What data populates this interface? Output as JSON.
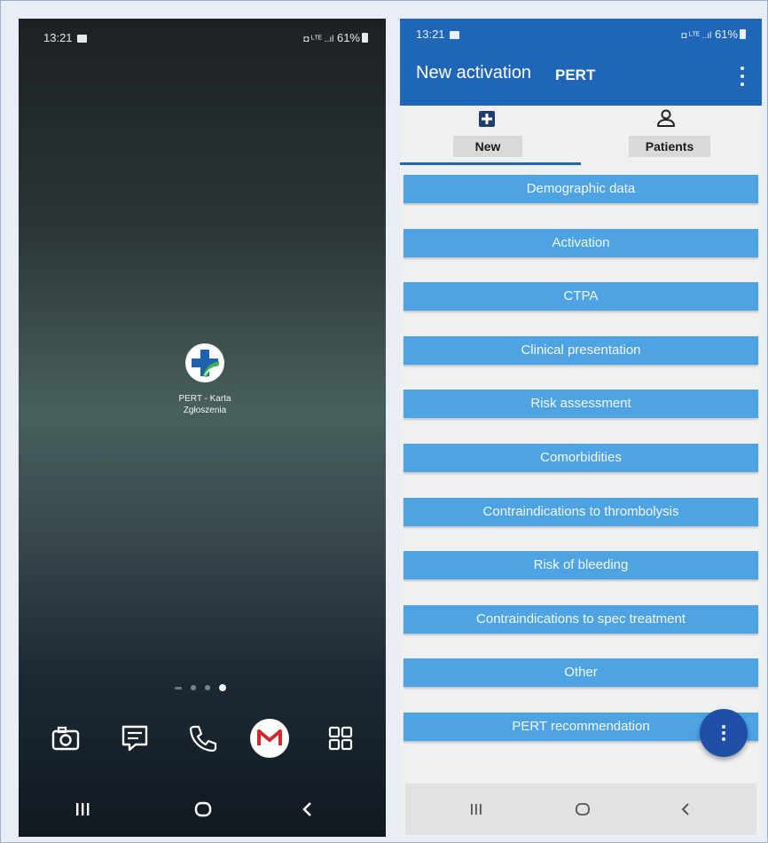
{
  "left_screen": {
    "status": {
      "time": "13:21",
      "battery": "61%"
    },
    "app": {
      "label_line1": "PERT - Karta",
      "label_line2": "Zgłoszenia",
      "icon": "pert-plus-icon"
    },
    "dock": [
      "camera-icon",
      "messages-icon",
      "phone-icon",
      "gmail-icon",
      "app-drawer-icon"
    ],
    "nav": [
      "recent-apps-icon",
      "home-icon",
      "back-icon"
    ]
  },
  "right_screen": {
    "status": {
      "time": "13:21",
      "battery": "61%"
    },
    "appbar": {
      "title": "New activation",
      "subtitle": "PERT"
    },
    "tabs": [
      {
        "label": "New",
        "icon": "add-box-icon"
      },
      {
        "label": "Patients",
        "icon": "person-icon"
      }
    ],
    "menu": [
      "Demographic data",
      "Activation",
      "CTPA",
      "Clinical presentation",
      "Risk assessment",
      "Comorbidities",
      "Contraindications to thrombolysis",
      "Risk of bleeding",
      "Contraindications to spec treatment",
      "Other",
      "PERT recommendation"
    ],
    "nav": [
      "recent-apps-icon",
      "home-icon",
      "back-icon"
    ]
  },
  "colors": {
    "primary": "#1f66b9",
    "button": "#4ea3e2",
    "fab": "#1f4fa8"
  }
}
